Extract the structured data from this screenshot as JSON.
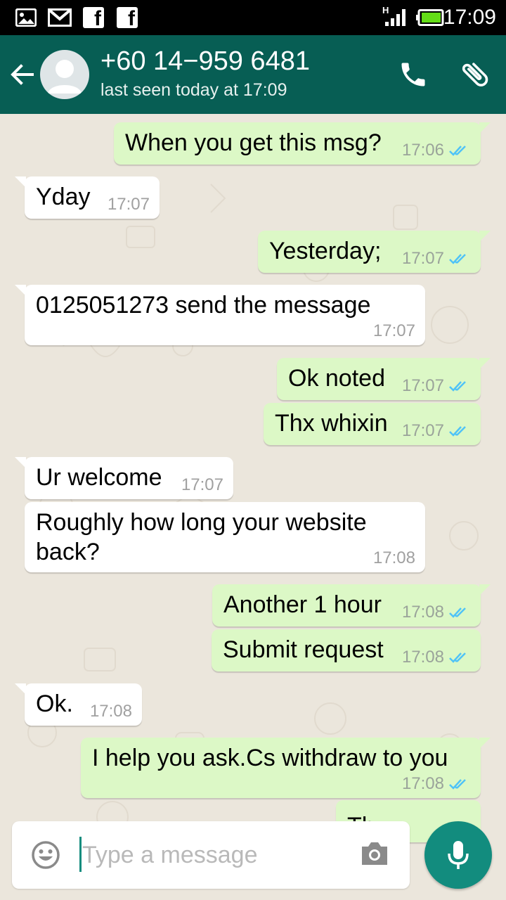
{
  "status_bar": {
    "time": "17:09",
    "signal_label": "H",
    "icons": [
      "gallery-icon",
      "gmail-icon",
      "facebook-icon",
      "facebook-icon",
      "signal-icon",
      "battery-icon"
    ]
  },
  "header": {
    "contact_name": "+60 14−959 6481",
    "last_seen": "last seen today at 17:09",
    "icons": [
      "back-arrow-icon",
      "avatar",
      "phone-icon",
      "attach-icon"
    ]
  },
  "messages": [
    {
      "dir": "out",
      "text": "When you get this msg?",
      "time": "17:06",
      "ticks": "read"
    },
    {
      "dir": "in",
      "text": "Yday",
      "time": "17:07"
    },
    {
      "dir": "out",
      "text": "Yesterday;",
      "time": "17:07",
      "ticks": "read"
    },
    {
      "dir": "in",
      "text": "0125051273 send the message",
      "time": "17:07"
    },
    {
      "dir": "out",
      "text": "Ok noted",
      "time": "17:07",
      "ticks": "read"
    },
    {
      "dir": "out",
      "text": "Thx whixin",
      "time": "17:07",
      "ticks": "read"
    },
    {
      "dir": "in",
      "text": "Ur welcome",
      "time": "17:07"
    },
    {
      "dir": "in",
      "text_line1": "Roughly how long your website",
      "text_line2": "back?",
      "time": "17:08"
    },
    {
      "dir": "out",
      "text": "Another 1 hour",
      "time": "17:08",
      "ticks": "read"
    },
    {
      "dir": "out",
      "text": "Submit request",
      "time": "17:08",
      "ticks": "read"
    },
    {
      "dir": "in",
      "text": "Ok.",
      "time": "17:08"
    },
    {
      "dir": "out",
      "text": "I help you ask.Cs withdraw to you",
      "time": "17:08",
      "ticks": "read"
    },
    {
      "dir": "out",
      "text": "Th",
      "partial": true
    }
  ],
  "composer": {
    "placeholder": "Type a message",
    "value": ""
  },
  "colors": {
    "header": "#075e54",
    "outgoing_bubble": "#dcf8c6",
    "incoming_bubble": "#ffffff",
    "read_ticks": "#4fc3f7",
    "mic_button": "#128c7e",
    "chat_background": "#ece5dd"
  }
}
